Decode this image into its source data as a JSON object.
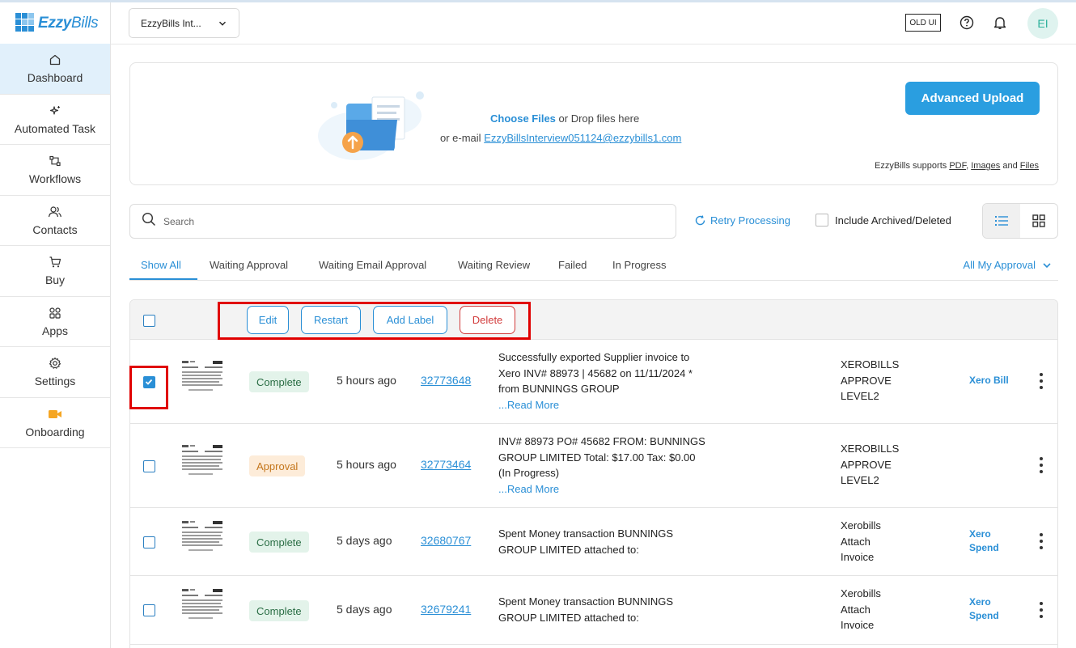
{
  "app": {
    "logo_text_1": "Ezzy",
    "logo_text_2": "Bills"
  },
  "sidebar": {
    "items": [
      {
        "label": "Dashboard",
        "icon": "home-icon"
      },
      {
        "label": "Automated Task",
        "icon": "sparkles-icon"
      },
      {
        "label": "Workflows",
        "icon": "workflow-icon"
      },
      {
        "label": "Contacts",
        "icon": "contacts-icon"
      },
      {
        "label": "Buy",
        "icon": "cart-icon"
      },
      {
        "label": "Apps",
        "icon": "apps-icon"
      },
      {
        "label": "Settings",
        "icon": "gear-icon"
      },
      {
        "label": "Onboarding",
        "icon": "video-icon"
      }
    ]
  },
  "header": {
    "org_name": "EzzyBills Int...",
    "old_ui_label": "OLD UI",
    "avatar_initials": "EI"
  },
  "upload": {
    "choose_files": "Choose Files",
    "drop_text": " or Drop files here",
    "email_prefix": "or e-mail ",
    "email": "EzzyBillsInterview051124@ezzybills1.com",
    "advanced_button": "Advanced Upload",
    "supports_prefix": "EzzyBills supports ",
    "pdf": "PDF",
    "sep": ", ",
    "images": "Images",
    "and": " and ",
    "files": "Files"
  },
  "search": {
    "placeholder": "Search"
  },
  "toolbar": {
    "retry_label": "Retry Processing",
    "include_archived_label": "Include Archived/Deleted"
  },
  "tabs": [
    {
      "label": "Show All",
      "active": true
    },
    {
      "label": "Waiting Approval"
    },
    {
      "label": "Waiting Email Approval"
    },
    {
      "label": "Waiting Review"
    },
    {
      "label": "Failed"
    },
    {
      "label": "In Progress"
    }
  ],
  "approval_filter": "All My Approval",
  "bulk_actions": {
    "edit": "Edit",
    "restart": "Restart",
    "add_label": "Add Label",
    "delete": "Delete"
  },
  "rows": [
    {
      "checked": true,
      "status": "Complete",
      "time": "5 hours ago",
      "id": "32773648",
      "description": "Successfully exported Supplier invoice to Xero INV# 88973 | 45682 on 11/11/2024 * from BUNNINGS GROUP",
      "read_more": "...Read More",
      "stage_lines": [
        "XEROBILLS",
        "APPROVE",
        "LEVEL2"
      ],
      "destination_lines": [
        "Xero Bill"
      ]
    },
    {
      "checked": false,
      "status": "Approval",
      "time": "5 hours ago",
      "id": "32773464",
      "description": "INV# 88973 PO# 45682 FROM: BUNNINGS GROUP LIMITED Total: $17.00 Tax: $0.00 (In Progress)",
      "read_more": "...Read More",
      "stage_lines": [
        "XEROBILLS",
        "APPROVE",
        "LEVEL2"
      ],
      "destination_lines": []
    },
    {
      "checked": false,
      "status": "Complete",
      "time": "5 days ago",
      "id": "32680767",
      "description": "Spent Money transaction BUNNINGS GROUP LIMITED attached to:",
      "read_more": "",
      "stage_lines": [
        "Xerobills",
        "Attach",
        "Invoice"
      ],
      "destination_lines": [
        "Xero",
        "Spend"
      ]
    },
    {
      "checked": false,
      "status": "Complete",
      "time": "5 days ago",
      "id": "32679241",
      "description": "Spent Money transaction BUNNINGS GROUP LIMITED attached to:",
      "read_more": "",
      "stage_lines": [
        "Xerobills",
        "Attach",
        "Invoice"
      ],
      "destination_lines": [
        "Xero",
        "Spend"
      ]
    }
  ],
  "colors": {
    "accent": "#2a8fd6",
    "highlight_box": "#e00000",
    "delete": "#d23b3b"
  }
}
